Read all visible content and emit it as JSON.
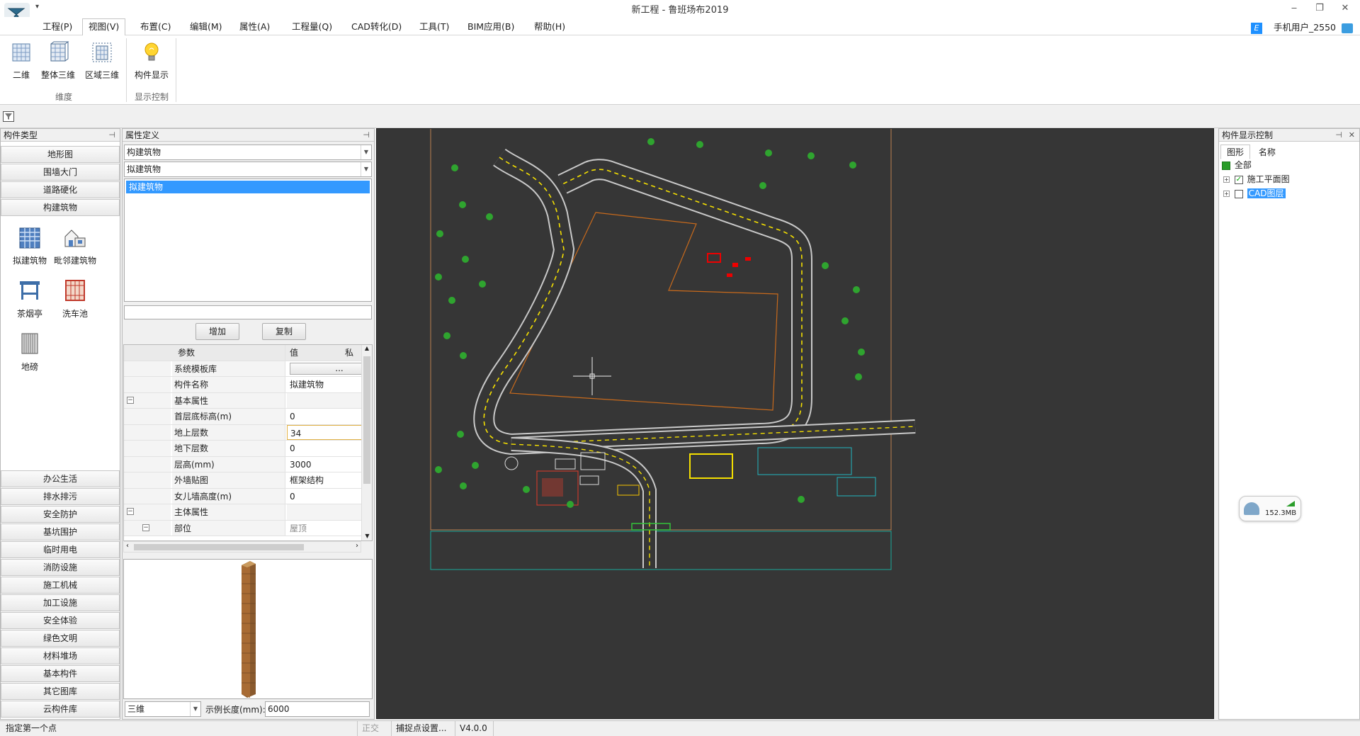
{
  "window": {
    "title": "新工程 - 鲁班场布2019",
    "quick_access": "▾",
    "min": "‒",
    "restore": "❐",
    "close": "✕"
  },
  "menu": [
    "工程(P)",
    "视图(V)",
    "布置(C)",
    "编辑(M)",
    "属性(A)",
    "工程量(Q)",
    "CAD转化(D)",
    "工具(T)",
    "BIM应用(B)",
    "帮助(H)"
  ],
  "menu_active": "视图(V)",
  "user": {
    "badge": "E",
    "name": "手机用户_2550"
  },
  "ribbon": {
    "buttons": [
      {
        "label": "二维",
        "icon": "grid-2d-icon"
      },
      {
        "label": "整体三维",
        "icon": "cube-3d-icon"
      },
      {
        "label": "区域三维",
        "icon": "region-3d-icon"
      },
      {
        "label": "构件显示",
        "icon": "lightbulb-icon"
      }
    ],
    "groups": [
      "维度",
      "显示控制"
    ]
  },
  "left_panel": {
    "title": "构件类型",
    "top_categories": [
      "地形图",
      "围墙大门",
      "道路硬化",
      "构建筑物"
    ],
    "components": [
      "拟建筑物",
      "毗邻建筑物",
      "茶烟亭",
      "洗车池",
      "地磅"
    ],
    "bottom_categories": [
      "办公生活",
      "排水排污",
      "安全防护",
      "基坑围护",
      "临时用电",
      "消防设施",
      "施工机械",
      "加工设施",
      "安全体验",
      "绿色文明",
      "材料堆场",
      "基本构件",
      "其它图库",
      "云构件库"
    ]
  },
  "prop_panel": {
    "title": "属性定义",
    "combo1": "构建筑物",
    "combo2": "拟建筑物",
    "list_items": [
      "拟建筑物"
    ],
    "add_button": "增加",
    "copy_button": "复制",
    "grid_headers": [
      "参数",
      "值",
      "私有"
    ],
    "rows": [
      {
        "name": "系统模板库",
        "value": "...",
        "type": "button"
      },
      {
        "name": "构件名称",
        "value": "拟建筑物"
      },
      {
        "name": "基本属性",
        "value": "",
        "group": true
      },
      {
        "name": "首层底标高(m)",
        "value": "0"
      },
      {
        "name": "地上层数",
        "value": "34",
        "selected": true
      },
      {
        "name": "地下层数",
        "value": "0"
      },
      {
        "name": "层高(mm)",
        "value": "3000"
      },
      {
        "name": "外墙贴图",
        "value": "框架结构"
      },
      {
        "name": "女儿墙高度(m)",
        "value": "0"
      },
      {
        "name": "主体属性",
        "value": "",
        "group": true
      },
      {
        "name": "部位",
        "value": "屋顶",
        "group": true,
        "muted": true
      }
    ],
    "preview_mode": "三维",
    "sample_label": "示例长度(mm):",
    "sample_value": "6000"
  },
  "right_panel": {
    "title": "构件显示控制",
    "tabs": [
      "图形",
      "名称"
    ],
    "tree": [
      {
        "label": "全部",
        "level": 0
      },
      {
        "label": "施工平面图",
        "level": 1,
        "checked": true
      },
      {
        "label": "CAD图层",
        "level": 1,
        "checked": false,
        "selected": true
      }
    ]
  },
  "memory_widget": "152.3MB",
  "status": {
    "prompt": "指定第一个点",
    "ortho": "正交",
    "snap": "捕捉点设置...",
    "version": "V4.0.0"
  },
  "colors": {
    "canvas": "#363636",
    "road": "#eaeaea",
    "lane": "#f5e000",
    "building": "#c86a1c",
    "tree": "#2fa42f",
    "selection": "#3399ff"
  }
}
